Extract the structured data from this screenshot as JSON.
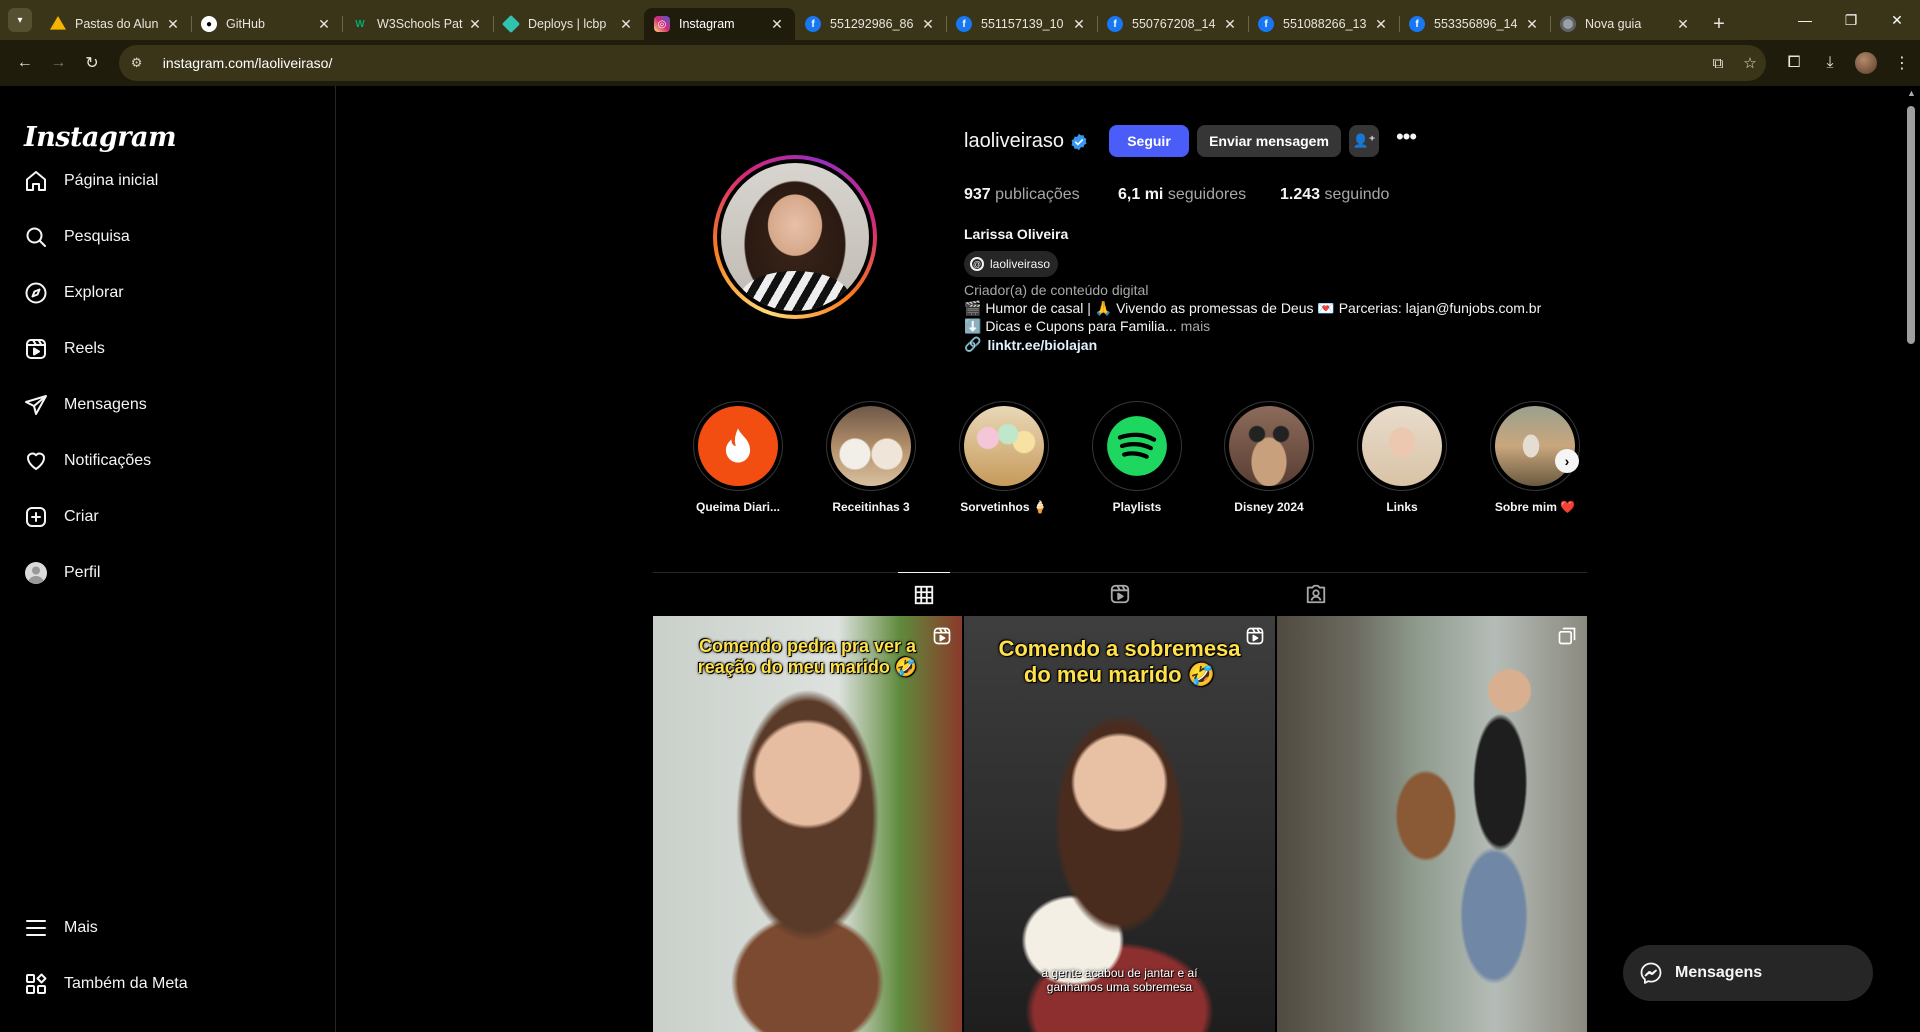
{
  "browser": {
    "tabs": [
      {
        "title": "Pastas do Alun",
        "favicon": "google-drive-icon",
        "color": "#f4b400"
      },
      {
        "title": "GitHub",
        "favicon": "github-icon",
        "color": "#ffffff"
      },
      {
        "title": "W3Schools Pat",
        "favicon": "w3schools-icon",
        "color": "#04aa6d"
      },
      {
        "title": "Deploys | lcbp",
        "favicon": "netlify-icon",
        "color": "#32c3b0"
      },
      {
        "title": "Instagram",
        "favicon": "instagram-icon",
        "color": "#e1306c"
      },
      {
        "title": "551292986_86",
        "favicon": "facebook-icon",
        "color": "#1877f2"
      },
      {
        "title": "551157139_10",
        "favicon": "facebook-icon",
        "color": "#1877f2"
      },
      {
        "title": "550767208_14",
        "favicon": "facebook-icon",
        "color": "#1877f2"
      },
      {
        "title": "551088266_13",
        "favicon": "facebook-icon",
        "color": "#1877f2"
      },
      {
        "title": "553356896_14",
        "favicon": "facebook-icon",
        "color": "#1877f2"
      },
      {
        "title": "Nova guia",
        "favicon": "chrome-icon",
        "color": "#9aa0a6"
      }
    ],
    "active_tab": "Instagram",
    "url": "instagram.com/laoliveiraso/"
  },
  "sidebar": {
    "logo": "Instagram",
    "items": [
      {
        "label": "Página inicial",
        "icon": "home-icon"
      },
      {
        "label": "Pesquisa",
        "icon": "search-icon"
      },
      {
        "label": "Explorar",
        "icon": "compass-icon"
      },
      {
        "label": "Reels",
        "icon": "reels-icon"
      },
      {
        "label": "Mensagens",
        "icon": "send-icon"
      },
      {
        "label": "Notificações",
        "icon": "heart-icon"
      },
      {
        "label": "Criar",
        "icon": "plus-square-icon"
      },
      {
        "label": "Perfil",
        "icon": "avatar-icon"
      }
    ],
    "bottom": [
      {
        "label": "Mais",
        "icon": "menu-icon"
      },
      {
        "label": "Também da Meta",
        "icon": "meta-apps-icon"
      }
    ]
  },
  "profile": {
    "username": "laoliveiraso",
    "follow_label": "Seguir",
    "message_label": "Enviar mensagem",
    "stats": {
      "posts_value": "937",
      "posts_label": "publicações",
      "followers_value": "6,1 mi",
      "followers_label": "seguidores",
      "following_value": "1.243",
      "following_label": "seguindo"
    },
    "name": "Larissa Oliveira",
    "threads_handle": "laoliveiraso",
    "category": "Criador(a) de conteúdo digital",
    "bio_line1": "🎬 Humor de casal | 🙏 Vivendo as promessas de Deus  💌 Parcerias: lajan@funjobs.com.br",
    "bio_line2": "⬇️ Dicas e Cupons para Familia...",
    "bio_more": "mais",
    "link": "linktr.ee/biolajan"
  },
  "highlights": [
    {
      "label": "Queima Diari..."
    },
    {
      "label": "Receitinhas 3"
    },
    {
      "label": "Sorvetinhos 🍦"
    },
    {
      "label": "Playlists"
    },
    {
      "label": "Disney 2024"
    },
    {
      "label": "Links"
    },
    {
      "label": "Sobre mim ❤️"
    }
  ],
  "posts": [
    {
      "overlay": "Comendo pedra pra ver a reação do meu marido 🤣",
      "caption": "",
      "type": "reel"
    },
    {
      "overlay": "Comendo a sobremesa do meu marido 🤣",
      "caption": "a gente acabou de jantar e aí ganhamos uma sobremesa",
      "type": "reel"
    },
    {
      "overlay": "",
      "caption": "",
      "type": "carousel"
    }
  ],
  "messages_pill": "Mensagens",
  "colors": {
    "follow_button": "#4a5df9",
    "secondary_button": "#363636",
    "browser_frame": "#3a3418",
    "browser_toolbar": "#1f1c0c"
  }
}
